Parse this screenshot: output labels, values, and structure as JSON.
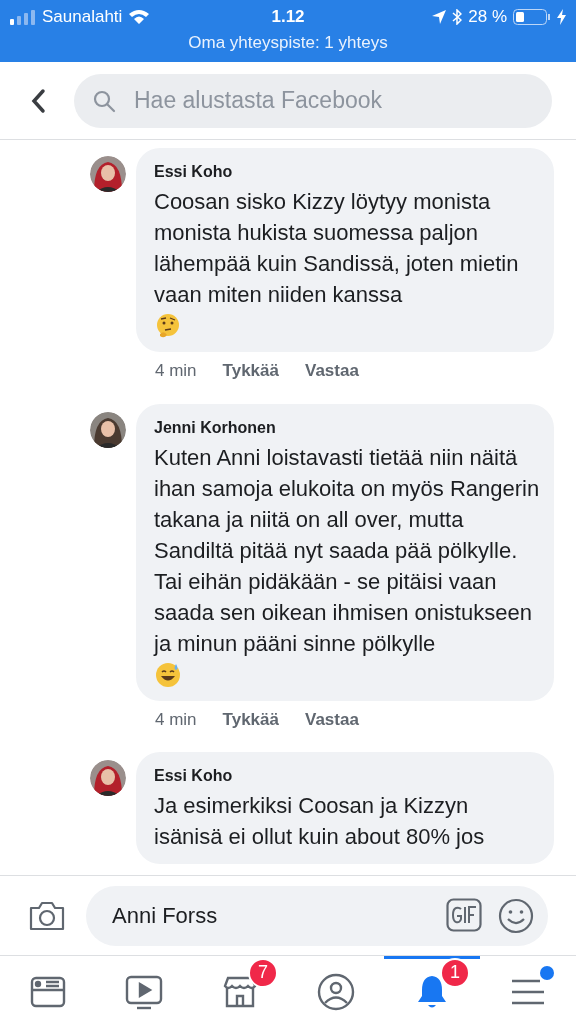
{
  "status_bar": {
    "carrier": "Saunalahti",
    "time": "1.12",
    "battery": "28 %",
    "hotspot": "Oma yhteyspiste: 1 yhteys"
  },
  "search": {
    "placeholder": "Hae alustasta Facebook"
  },
  "comments": [
    {
      "author": "Essi Koho",
      "text": "Coosan sisko Kizzy löytyy monista monista hukista suomessa paljon lähempää kuin Sandissä, joten mietin vaan miten niiden kanssa",
      "kind": "thinking",
      "time": "4 min",
      "like": "Tykkää",
      "reply": "Vastaa"
    },
    {
      "author": "Jenni Korhonen",
      "text": "Kuten Anni loistavasti tietää niin näitä ihan samoja elukoita on myös Rangerin takana ja niitä on all over, mutta Sandiltä pitää nyt saada pää pölkylle. Tai eihän pidäkään - se pitäisi vaan saada sen oikean ihmisen onistukseen ja minun pääni sinne pölkylle",
      "kind": "sweat",
      "time": "4 min",
      "like": "Tykkää",
      "reply": "Vastaa"
    },
    {
      "author": "Essi Koho",
      "text": "Ja esimerkiksi Coosan ja Kizzyn isänisä ei ollut kuin about 80% jos",
      "kind": "plain"
    }
  ],
  "composer": {
    "value": "Anni Forss"
  },
  "tabs": [
    {
      "kind": "feed",
      "selected": false
    },
    {
      "kind": "watch",
      "selected": false
    },
    {
      "kind": "marketplace",
      "selected": false,
      "badge": "7"
    },
    {
      "kind": "profile",
      "selected": false
    },
    {
      "kind": "notifications",
      "selected": true,
      "badge": "1"
    },
    {
      "kind": "menu",
      "selected": false,
      "dot": true
    }
  ]
}
